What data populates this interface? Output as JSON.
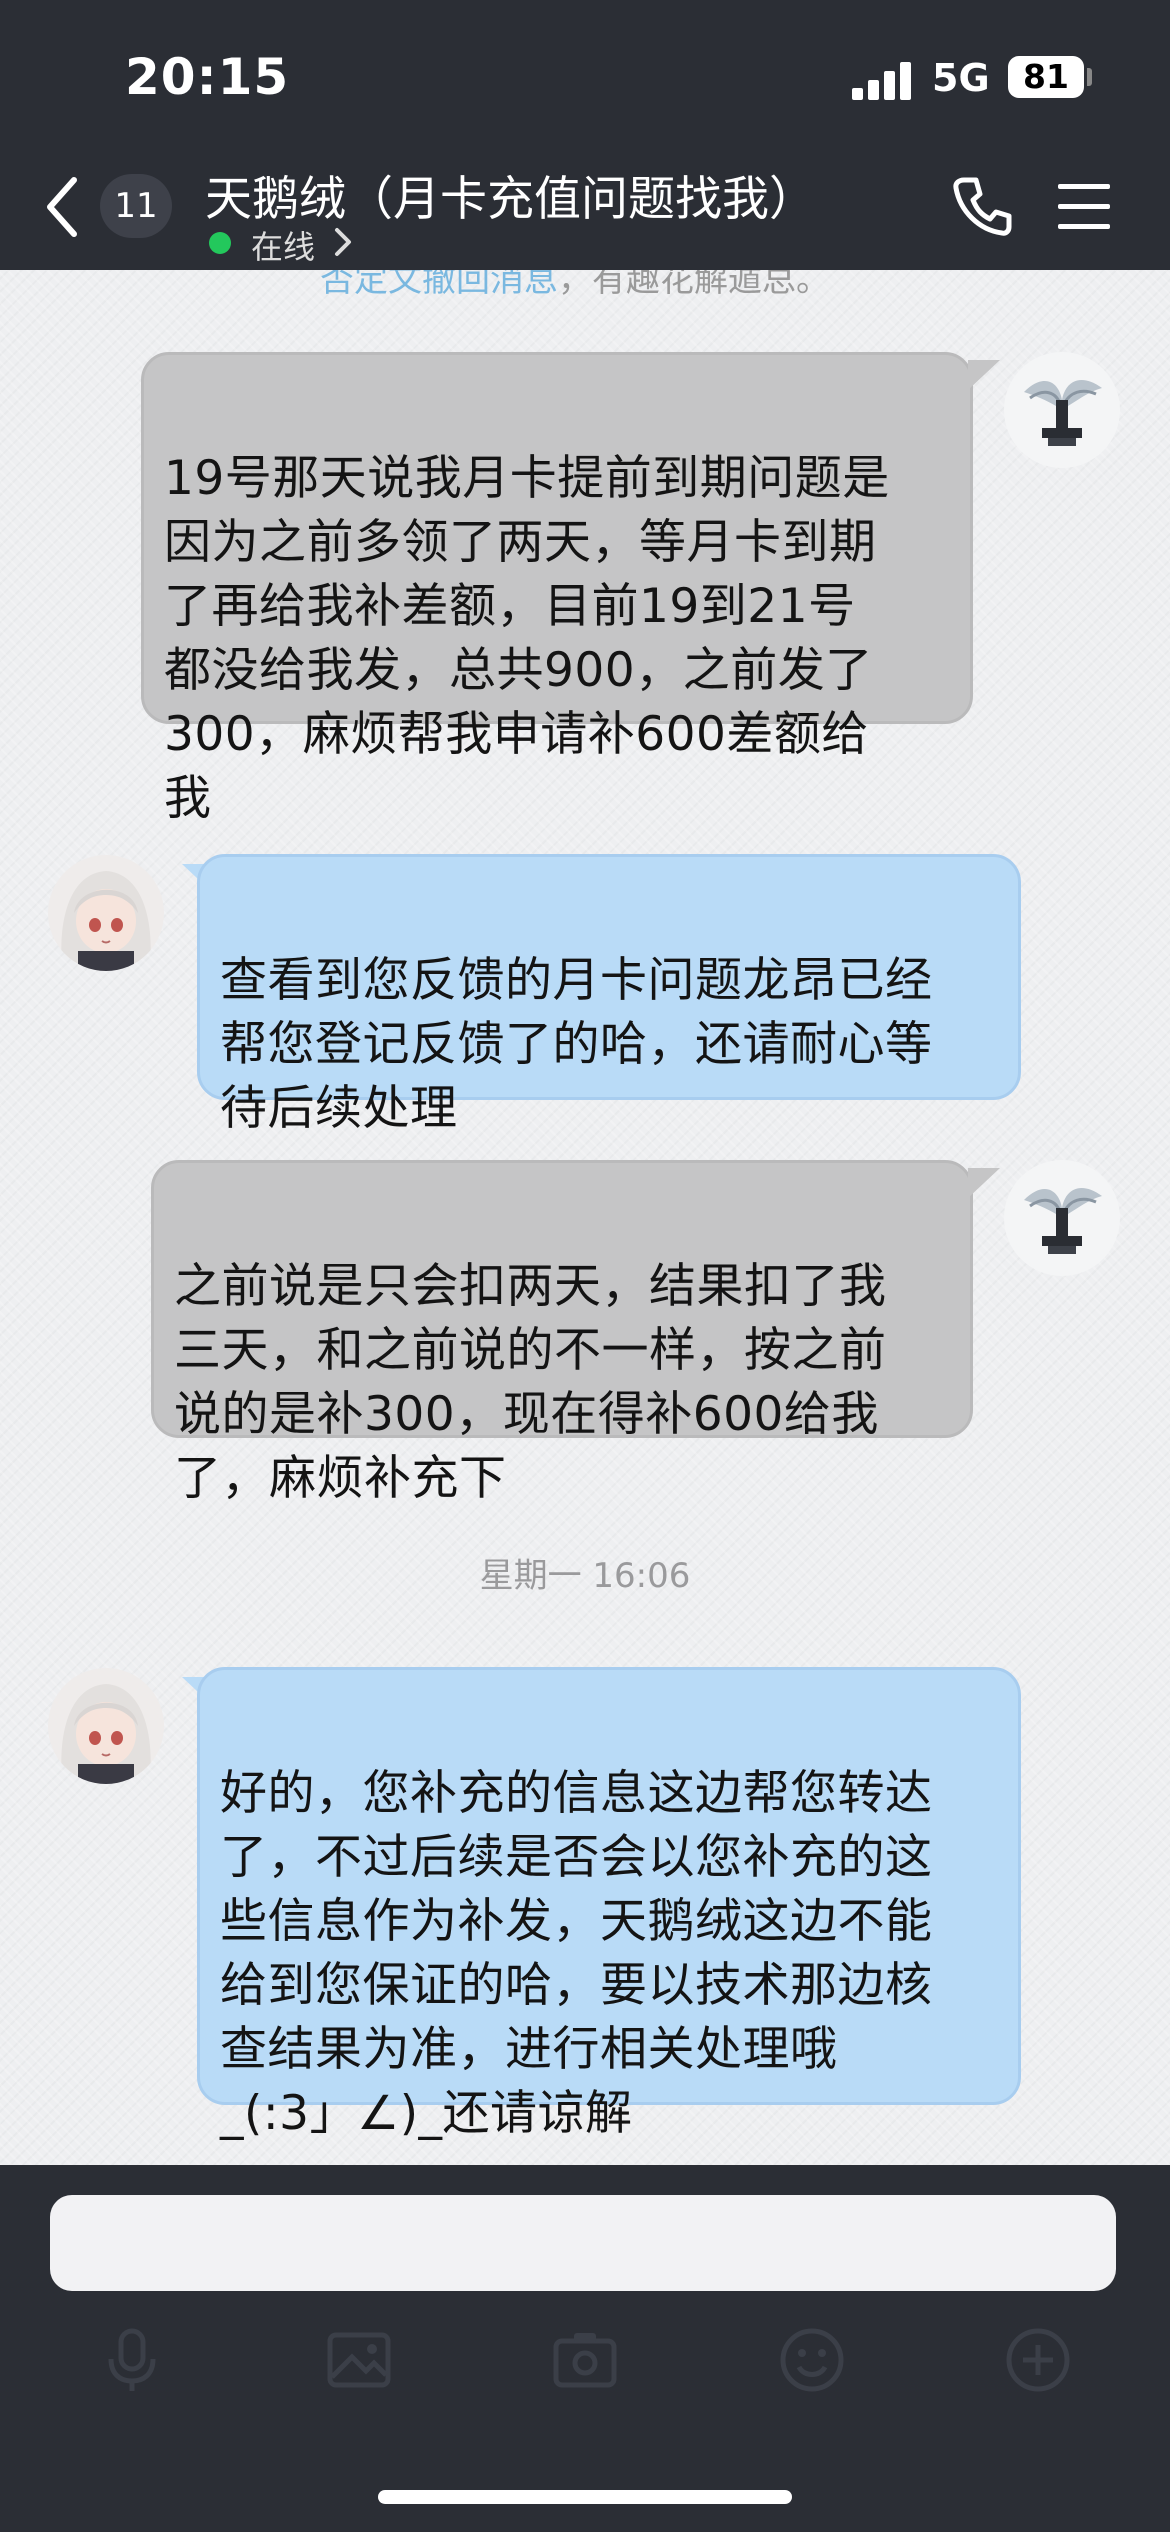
{
  "status_bar": {
    "time": "20:15",
    "network": "5G",
    "battery": "81"
  },
  "header": {
    "unread_count": "11",
    "title": "天鹅绒（月卡充值问题找我）",
    "presence": "在线"
  },
  "chat": {
    "previous_message_fragment": {
      "link_part": "否定文撤回消息",
      "rest_part": "，有趣花解遁总。"
    },
    "messages": [
      {
        "side": "right",
        "text": "19号那天说我月卡提前到期问题是\n因为之前多领了两天，等月卡到期\n了再给我补差额，目前19到21号\n都没给我发，总共900，之前发了\n300，麻烦帮我申请补600差额给\n我"
      },
      {
        "side": "left",
        "text": "查看到您反馈的月卡问题龙昂已经\n帮您登记反馈了的哈，还请耐心等\n待后续处理"
      },
      {
        "side": "right",
        "text": "之前说是只会扣两天，结果扣了我\n三天，和之前说的不一样，按之前\n说的是补300，现在得补600给我\n了，麻烦补充下"
      },
      {
        "side": "left",
        "text": "好的，您补充的信息这边帮您转达\n了，不过后续是否会以您补充的这\n些信息作为补发，天鹅绒这边不能\n给到您保证的哈，要以技术那边核\n查结果为准，进行相关处理哦\n_(:3」∠)_还请谅解"
      }
    ],
    "timestamp": "星期一 16:06"
  },
  "composer": {
    "input_value": "",
    "tools": [
      "microphone-icon",
      "image-icon",
      "camera-icon",
      "emoji-icon",
      "plus-icon"
    ]
  },
  "colors": {
    "header_bg": "#2b2e35",
    "sent_bubble": "#c5c5c6",
    "received_bubble": "#b9dbf7",
    "online": "#23c85c"
  }
}
